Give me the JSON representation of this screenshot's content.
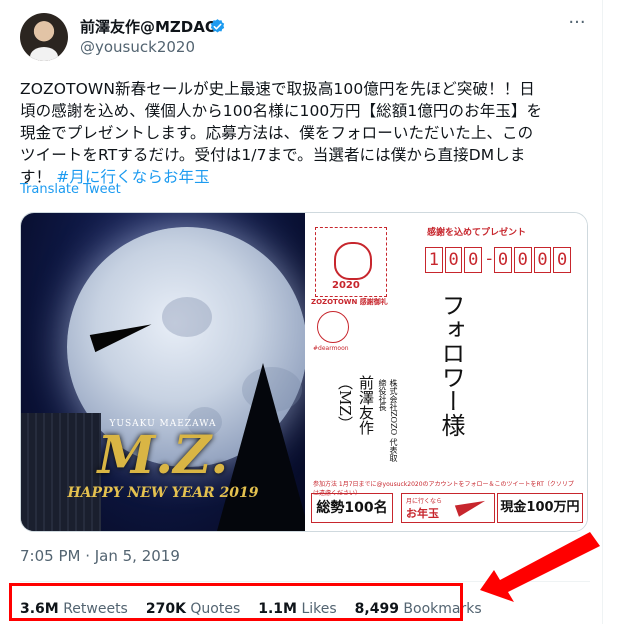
{
  "author": {
    "name": "前澤友作@MZDAO",
    "handle": "@yousuck2020",
    "verified": true
  },
  "tweet": {
    "text_line1": "ZOZOTOWN新春セールが史上最速で取扱高100億円を先ほど突破！！日",
    "text_line2": "頃の感謝を込め、僕個人から100名様に100万円【総額1億円のお年玉】を",
    "text_line3": "現金でプレゼントします。応募方法は、僕をフォローいただいた上、この",
    "text_line4": "ツイートをRTするだけ。受付は1/7まで。当選者には僕から直接DMしま",
    "text_line5": "す！",
    "hashtag": "#月に行くならお年玉",
    "translate": "Translate Tweet"
  },
  "media": {
    "artist": "YUSAKU MAEZAWA",
    "logo": "M.Z.",
    "greeting": "HAPPY NEW YEAR 2019",
    "card_header": "感謝を込めてプレゼント",
    "postal_digits": [
      "1",
      "0",
      "0",
      "-",
      "0",
      "0",
      "0",
      "0"
    ],
    "stamp_year": "2020",
    "stamp_label": "ZOZOTOWN 感謝御礼",
    "stamp2_label": "#dearmoon",
    "recipient": "フォロワー様",
    "company": "株式会社ZOZO 代表取締役社長",
    "sender": "前澤友作（MZ）",
    "notice": "参加方法 1月7日までに@yousuck2020のアカウントをフォロー＆このツイートをRT（クソリプは遠慮ください）",
    "prize_total": "総勢100名",
    "prize_mid_small": "月に行くなら",
    "prize_mid_big": "お年玉",
    "prize_amount": "現金100万円"
  },
  "timestamp": "7:05 PM · Jan 5, 2019",
  "stats": {
    "retweets_value": "3.6M",
    "retweets_label": "Retweets",
    "quotes_value": "270K",
    "quotes_label": "Quotes",
    "likes_value": "1.1M",
    "likes_label": "Likes",
    "bookmarks_value": "8,499",
    "bookmarks_label": "Bookmarks"
  },
  "icons": {
    "verified": "verified-badge-icon",
    "more": "more-options-icon"
  },
  "colors": {
    "link": "#1d9bf0",
    "text": "#0f1419",
    "muted": "#536471",
    "highlight": "#ff0000",
    "card_red": "#c7262d"
  }
}
